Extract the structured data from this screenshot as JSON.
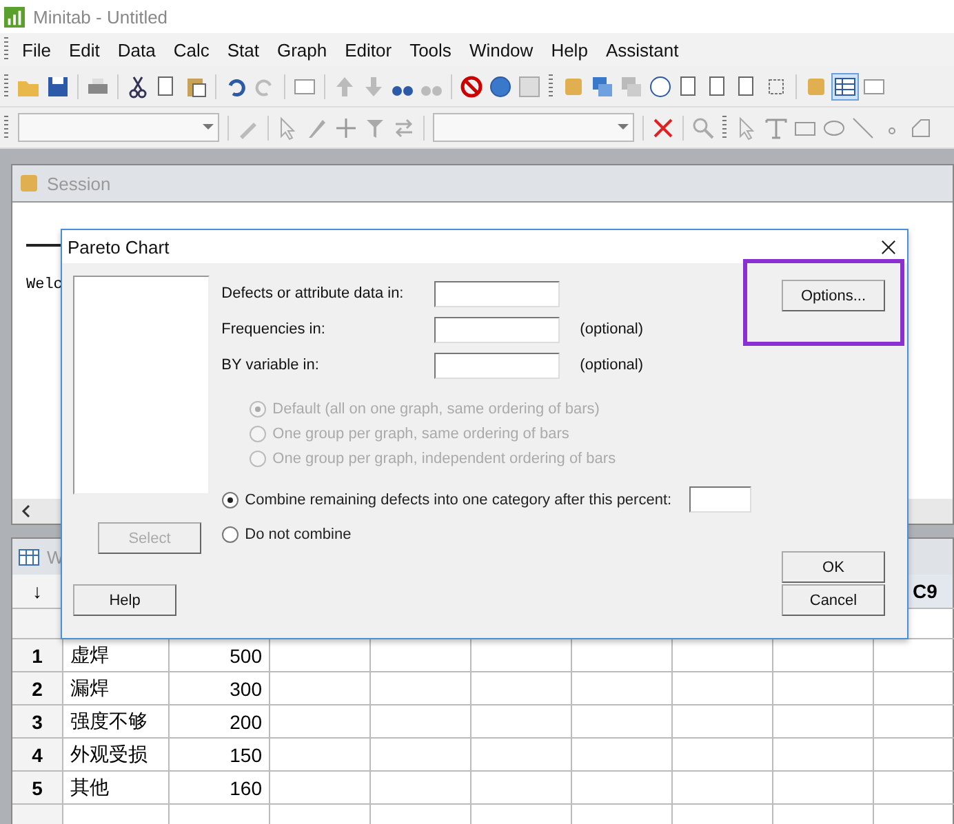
{
  "window": {
    "title": "Minitab - Untitled"
  },
  "menu": [
    "File",
    "Edit",
    "Data",
    "Calc",
    "Stat",
    "Graph",
    "Editor",
    "Tools",
    "Window",
    "Help",
    "Assistant"
  ],
  "session": {
    "title": "Session",
    "text": "Welc"
  },
  "worksheet": {
    "title": "W",
    "corner": "↓",
    "last_column": "C9",
    "rows": [
      {
        "n": "1",
        "c1": "虚焊",
        "c2": "500"
      },
      {
        "n": "2",
        "c1": "漏焊",
        "c2": "300"
      },
      {
        "n": "3",
        "c1": "强度不够",
        "c2": "200"
      },
      {
        "n": "4",
        "c1": "外观受损",
        "c2": "150"
      },
      {
        "n": "5",
        "c1": "其他",
        "c2": "160"
      }
    ]
  },
  "dialog": {
    "title": "Pareto Chart",
    "fields": [
      {
        "label": "Defects or attribute data in:"
      },
      {
        "label": "Frequencies in:",
        "note": "(optional)"
      },
      {
        "label": "BY variable in:",
        "note": "(optional)"
      }
    ],
    "by_options": [
      {
        "label": "Default (all on one graph, same ordering of bars)",
        "selected": true,
        "disabled": true
      },
      {
        "label": "One group per graph, same ordering of bars",
        "selected": false,
        "disabled": true
      },
      {
        "label": "One group per graph, independent ordering of bars",
        "selected": false,
        "disabled": true
      }
    ],
    "combine_options": [
      {
        "label": "Combine remaining defects into one category after this percent:",
        "selected": true,
        "has_field": true
      },
      {
        "label": "Do not combine",
        "selected": false,
        "has_field": false
      }
    ],
    "select_button": {
      "label": "Select",
      "disabled": true
    },
    "help_button": "Help",
    "options_button": {
      "label": "Options...",
      "highlighted": true
    },
    "ok_button": "OK",
    "cancel_button": "Cancel"
  }
}
